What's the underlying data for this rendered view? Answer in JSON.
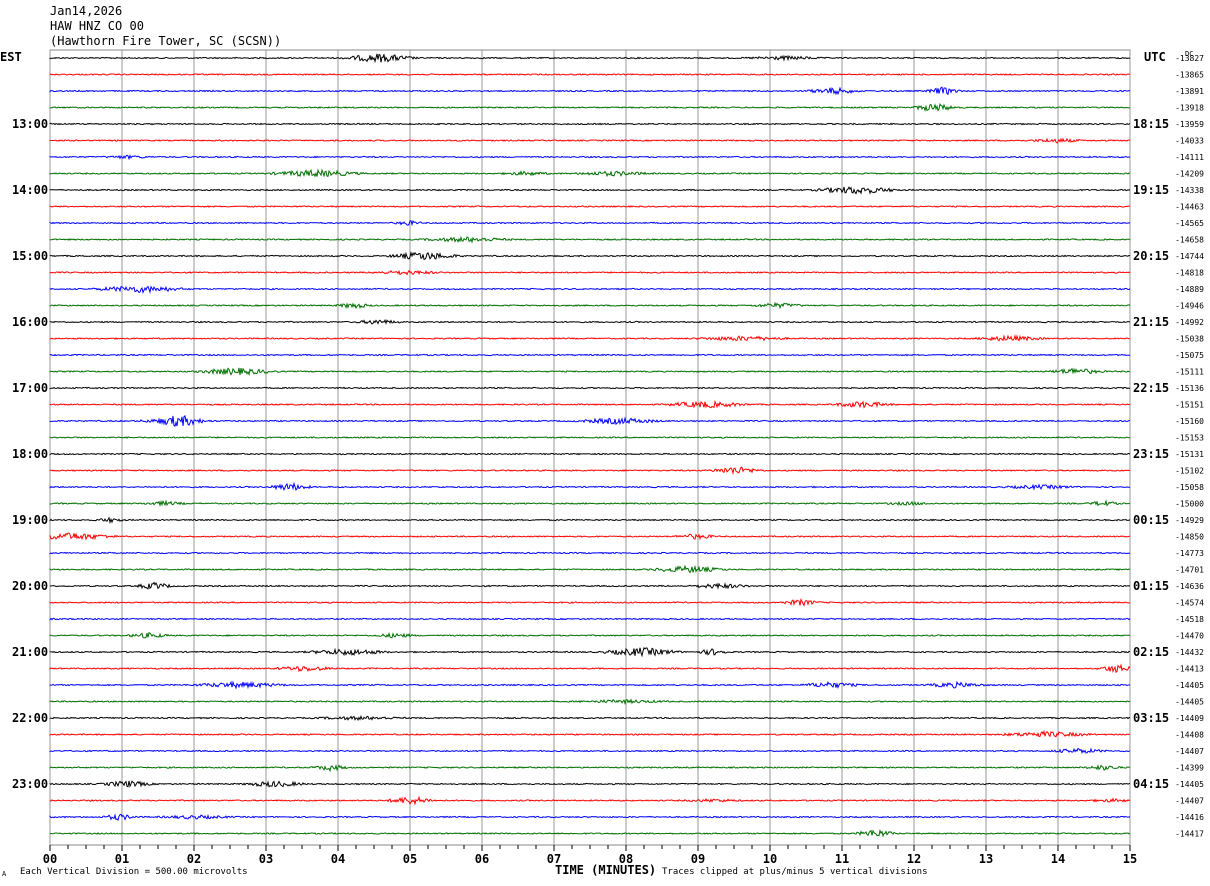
{
  "header": {
    "date": "Jan14,2026",
    "channel": "HAW HNZ CO 00",
    "station": "(Hawthorn Fire Tower, SC (SCSN))"
  },
  "left_zone": "EST",
  "right_zone": "UTC",
  "dc_label": "DC",
  "footer": {
    "scale_note": "Each Vertical Division =  500.00 microvolts",
    "xlabel": "TIME (MINUTES)",
    "clip_note": "Traces clipped at plus/minus 5 vertical divisions",
    "mark": "A"
  },
  "chart_data": {
    "type": "line",
    "subtype": "helicorder",
    "xlabel": "TIME (MINUTES)",
    "xlim": [
      0,
      15
    ],
    "x_ticks": [
      "00",
      "01",
      "02",
      "03",
      "04",
      "05",
      "06",
      "07",
      "08",
      "09",
      "10",
      "11",
      "12",
      "13",
      "14",
      "15"
    ],
    "grid": "vertical lines every minute",
    "trace_colors": [
      "#000000",
      "#ff0000",
      "#0000ff",
      "#007000"
    ],
    "left_hour_labels": [
      "13:00",
      "14:00",
      "15:00",
      "16:00",
      "17:00",
      "18:00",
      "19:00",
      "20:00",
      "21:00",
      "22:00",
      "23:00"
    ],
    "right_hour_labels": [
      "18:15",
      "19:15",
      "20:15",
      "21:15",
      "22:15",
      "23:15",
      "00:15",
      "01:15",
      "02:15",
      "03:15",
      "04:15"
    ],
    "dc_offsets": [
      -13827,
      -13865,
      -13891,
      -13918,
      -13959,
      -14033,
      -14111,
      -14209,
      -14338,
      -14463,
      -14565,
      -14658,
      -14744,
      -14818,
      -14889,
      -14946,
      -14992,
      -15038,
      -15075,
      -15111,
      -15136,
      -15151,
      -15160,
      -15153,
      -15131,
      -15102,
      -15058,
      -15000,
      -14929,
      -14850,
      -14773,
      -14701,
      -14636,
      -14574,
      -14518,
      -14470,
      -14432,
      -14413,
      -14405,
      -14405,
      -14409,
      -14408,
      -14407,
      -14399,
      -14405,
      -14407,
      -14416,
      -14417
    ]
  }
}
